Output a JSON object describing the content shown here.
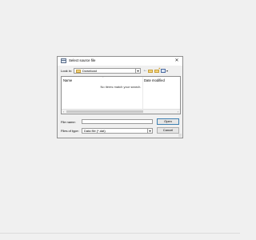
{
  "dialog": {
    "title": "Select source file",
    "close_glyph": "✕",
    "icon": "dialog-window-icon"
  },
  "toolbar": {
    "look_in_label": "Look in:",
    "look_in_value": "Download",
    "dropdown_glyph": "▾",
    "back_glyph": "←",
    "icons": [
      "back-icon",
      "up-folder-icon",
      "new-folder-icon",
      "view-menu-icon"
    ]
  },
  "filelist": {
    "columns": [
      "Name",
      "Date modified"
    ],
    "empty_message": "No items match your search.",
    "scroll_left_glyph": "‹",
    "scroll_right_glyph": "›"
  },
  "form": {
    "file_name_label": "File name:",
    "file_name_value": "",
    "file_type_label": "Files of type:",
    "file_type_value": "Data file (*.dat)"
  },
  "buttons": {
    "open": "Open",
    "cancel": "Cancel"
  }
}
